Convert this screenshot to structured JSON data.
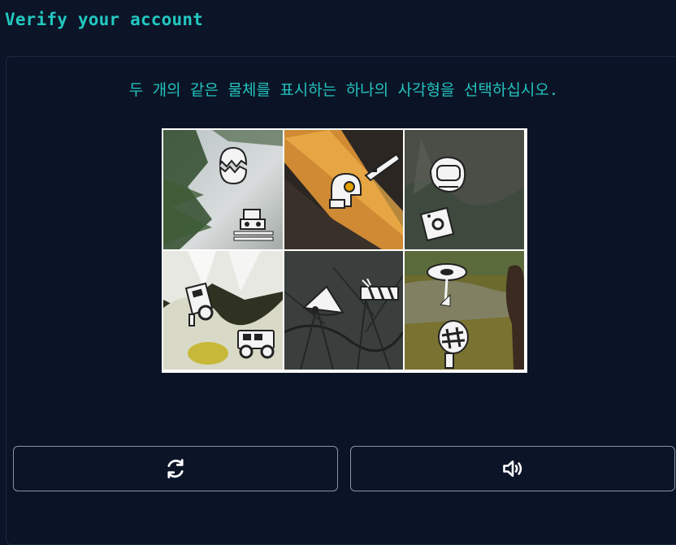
{
  "header": {
    "title": "Verify your account"
  },
  "challenge": {
    "instruction": "두 개의 같은 물체를 표시하는 하나의 사각형을 선택하십시오.",
    "tiles": [
      {
        "id": 1,
        "icons": [
          "hatching-egg-icon",
          "train-icon"
        ]
      },
      {
        "id": 2,
        "icons": [
          "helmet-icon",
          "pen-icon"
        ]
      },
      {
        "id": 3,
        "icons": [
          "backpack-icon",
          "card-icon"
        ]
      },
      {
        "id": 4,
        "icons": [
          "jeep-icon",
          "jeep-icon"
        ]
      },
      {
        "id": 5,
        "icons": [
          "bell-icon",
          "train-icon"
        ]
      },
      {
        "id": 6,
        "icons": [
          "lamp-icon",
          "racket-icon"
        ]
      }
    ]
  },
  "controls": {
    "refresh_icon": "refresh-icon",
    "audio_icon": "speaker-icon"
  },
  "colors": {
    "accent": "#22c8c0",
    "background": "#0c1528"
  }
}
